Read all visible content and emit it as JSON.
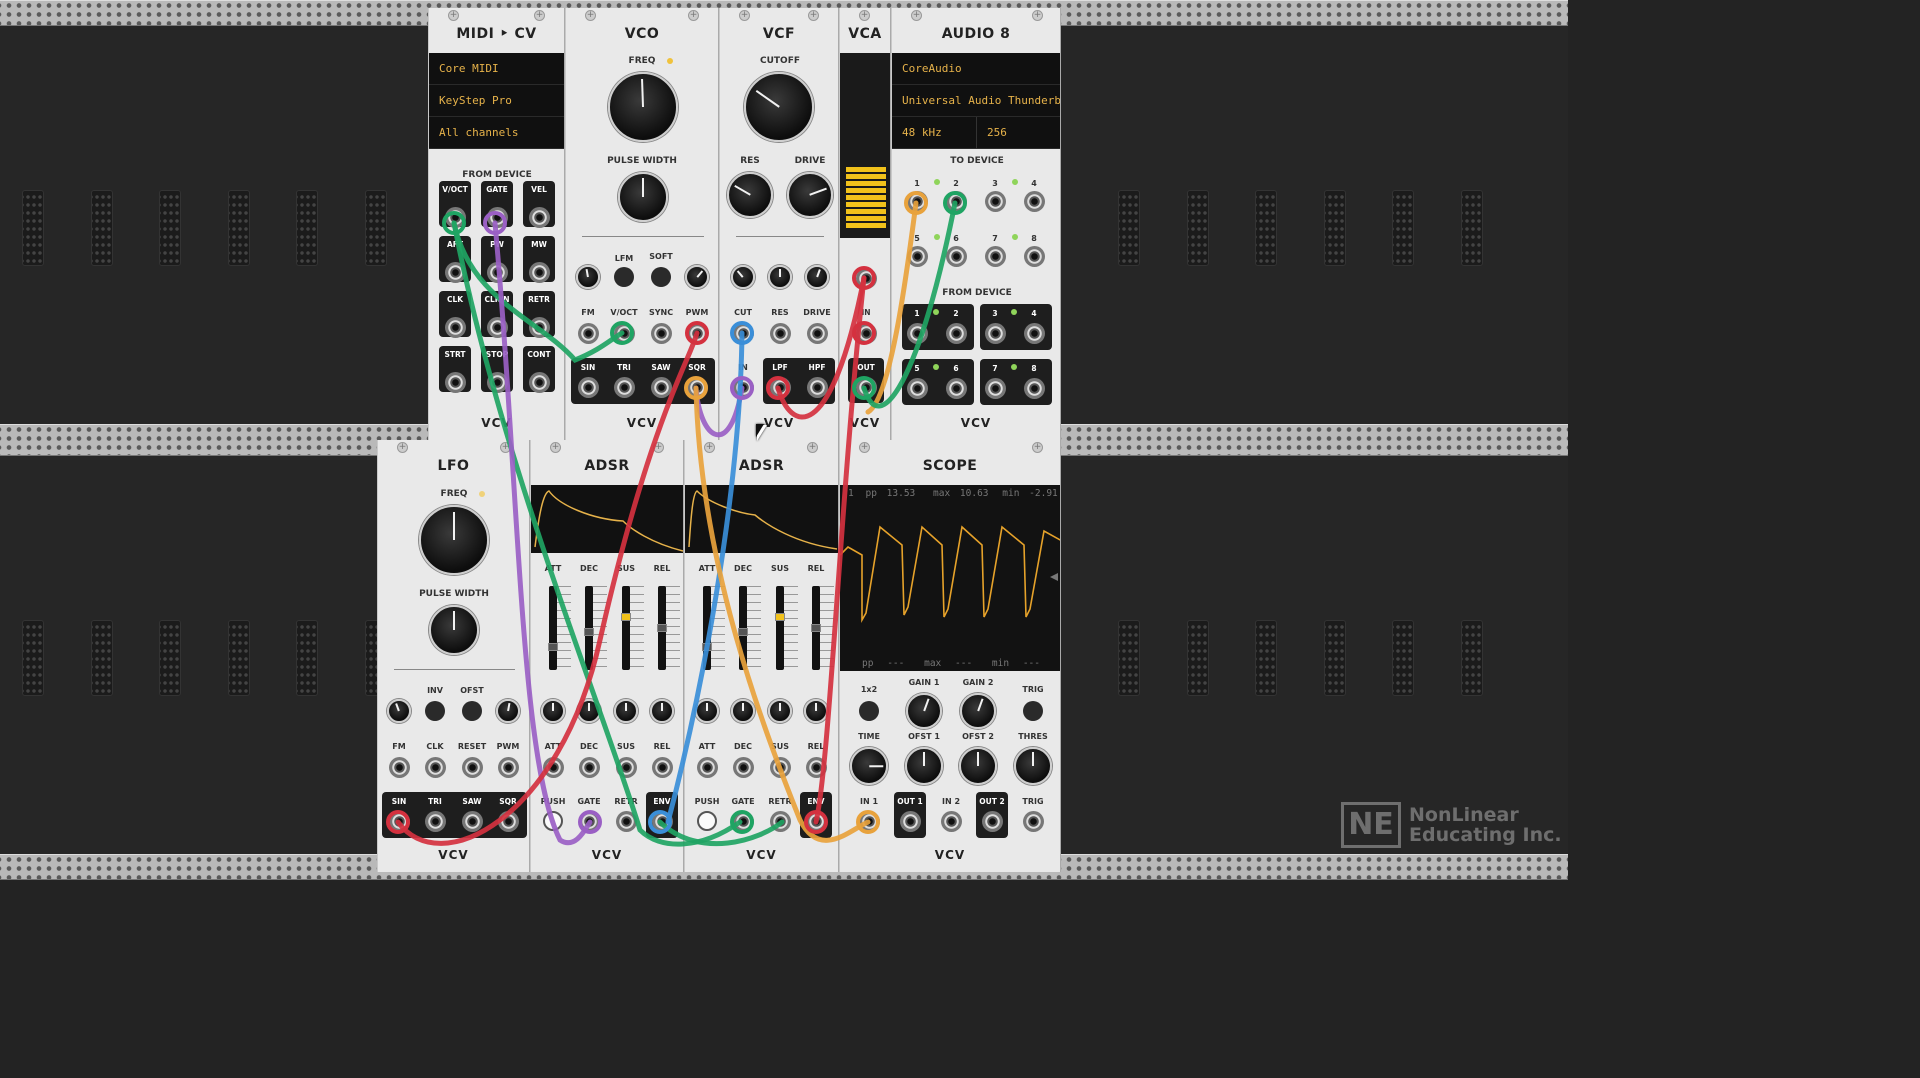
{
  "midi_cv": {
    "title": "MIDI ‣ CV",
    "driver": "Core MIDI",
    "device": "KeyStep Pro",
    "channel": "All channels",
    "section": "FROM DEVICE",
    "jacks": [
      "V/OCT",
      "GATE",
      "VEL",
      "AFT",
      "PW",
      "MW",
      "CLK",
      "CLK/N",
      "RETR",
      "STRT",
      "STOP",
      "CONT"
    ]
  },
  "vco": {
    "title": "VCO",
    "freq_label": "FREQ",
    "pw_label": "PULSE WIDTH",
    "switches": [
      "LFM",
      "SOFT"
    ],
    "inputs": [
      "FM",
      "V/OCT",
      "SYNC",
      "PWM"
    ],
    "outputs": [
      "SIN",
      "TRI",
      "SAW",
      "SQR"
    ]
  },
  "vcf": {
    "title": "VCF",
    "cutoff_label": "CUTOFF",
    "res_label": "RES",
    "drive_label": "DRIVE",
    "inputs": [
      "CUT",
      "RES",
      "DRIVE"
    ],
    "in_label": "IN",
    "outputs": [
      "LPF",
      "HPF"
    ]
  },
  "vca": {
    "title": "VCA",
    "in_label": "IN",
    "out_label": "OUT",
    "level": 0.45
  },
  "audio8": {
    "title": "AUDIO 8",
    "driver": "CoreAudio",
    "device": "Universal Audio Thunderbo",
    "rate": "48 kHz",
    "block": "256",
    "to_device": "TO DEVICE",
    "from_device": "FROM DEVICE",
    "nums": [
      "1",
      "2",
      "3",
      "4",
      "5",
      "6",
      "7",
      "8"
    ]
  },
  "lfo": {
    "title": "LFO",
    "freq_label": "FREQ",
    "pw_label": "PULSE WIDTH",
    "switches": [
      "INV",
      "OFST"
    ],
    "inputs": [
      "FM",
      "CLK",
      "RESET",
      "PWM"
    ],
    "outputs": [
      "SIN",
      "TRI",
      "SAW",
      "SQR"
    ]
  },
  "adsr1": {
    "title": "ADSR",
    "sliders": [
      "ATT",
      "DEC",
      "SUS",
      "REL"
    ],
    "inputs": [
      "ATT",
      "DEC",
      "SUS",
      "REL"
    ],
    "bottom": [
      "PUSH",
      "GATE",
      "RETR",
      "ENV"
    ]
  },
  "adsr2": {
    "title": "ADSR",
    "sliders": [
      "ATT",
      "DEC",
      "SUS",
      "REL"
    ],
    "inputs": [
      "ATT",
      "DEC",
      "SUS",
      "REL"
    ],
    "bottom": [
      "PUSH",
      "GATE",
      "RETR",
      "ENV"
    ]
  },
  "scope": {
    "title": "SCOPE",
    "readout_top": {
      "ch": "1",
      "pp_label": "pp",
      "pp": "13.53",
      "max_label": "max",
      "max": "10.63",
      "min_label": "min",
      "min": "-2.91"
    },
    "readout_bottom": {
      "pp_label": "pp",
      "pp": "---",
      "max_label": "max",
      "max": "---",
      "min_label": "min",
      "min": "---"
    },
    "x2_label": "1x2",
    "gain1": "GAIN 1",
    "gain2": "GAIN 2",
    "trig": "TRIG",
    "time": "TIME",
    "ofst1": "OFST 1",
    "ofst2": "OFST 2",
    "thres": "THRES",
    "jacks": [
      "IN 1",
      "OUT 1",
      "IN 2",
      "OUT 2",
      "TRIG"
    ]
  },
  "brand": "VCV",
  "watermark": {
    "logo": "NE",
    "line1": "NonLinear",
    "line2": "Educating Inc."
  },
  "colors": {
    "green": "#1fa463",
    "purple": "#9a5fc4",
    "red": "#d4313f",
    "blue": "#3a8ed8",
    "orange": "#e8a23c",
    "display_text": "#e6b24a"
  }
}
